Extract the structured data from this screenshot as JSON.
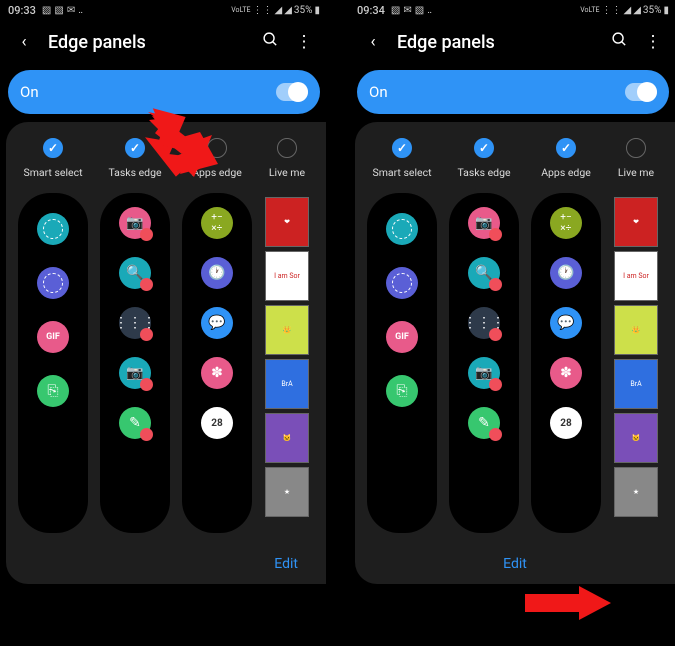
{
  "status": {
    "time_left": "09:33",
    "time_right": "09:34",
    "battery": "35%",
    "net_label": "VoLTE"
  },
  "header": {
    "title": "Edge panels"
  },
  "toggle": {
    "label": "On"
  },
  "panels": {
    "items": [
      {
        "label": "Smart select",
        "checked_left": true,
        "checked_right": true
      },
      {
        "label": "Tasks edge",
        "checked_left": true,
        "checked_right": true
      },
      {
        "label": "Apps edge",
        "checked_left": false,
        "checked_right": true
      },
      {
        "label": "Live me",
        "checked_left": false,
        "checked_right": false
      }
    ]
  },
  "edit_label": "Edit",
  "icon_colors": {
    "teal": "#1aa9b8",
    "purple": "#5a5fd6",
    "pink": "#e85a8a",
    "green": "#37c76f",
    "blue": "#2f93f6",
    "olive": "#8aa821",
    "dark": "#2e3a4a"
  },
  "live_tiles": [
    "❤",
    "I am Sor",
    "👑",
    "BrA",
    "🐱",
    "★"
  ]
}
